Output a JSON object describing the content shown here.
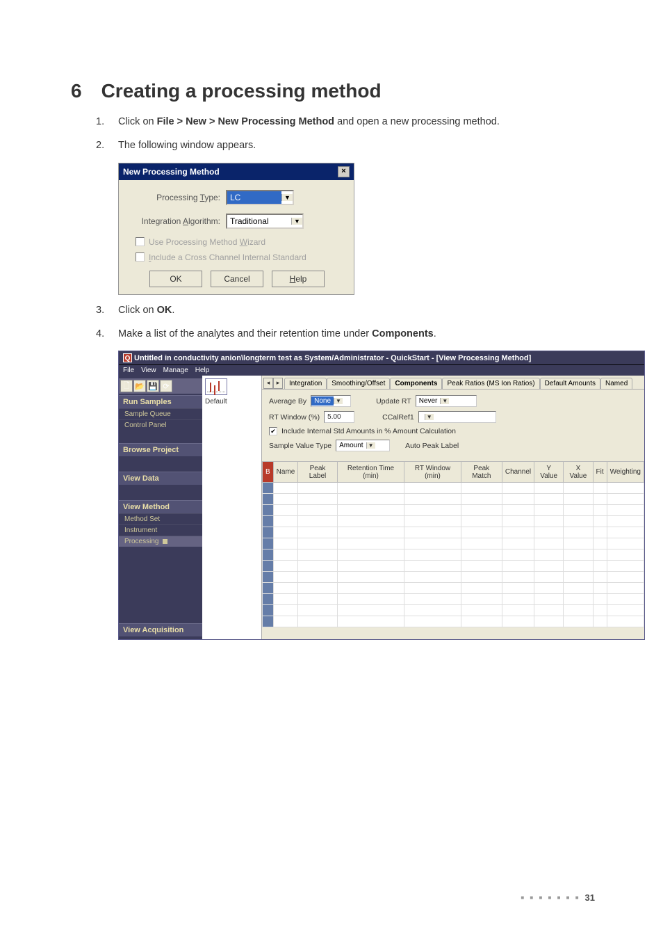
{
  "heading": {
    "number": "6",
    "title": "Creating a processing method"
  },
  "steps": {
    "1": {
      "num": "1.",
      "pre": "Click on ",
      "bold": "File > New > New Processing Method",
      "post": " and open a new processing method."
    },
    "2": {
      "num": "2.",
      "text": "The following window appears."
    },
    "3": {
      "num": "3.",
      "pre": "Click on ",
      "bold": "OK",
      "post": "."
    },
    "4": {
      "num": "4.",
      "pre": "Make a list of the analytes and their retention time under ",
      "bold": "Components",
      "post": "."
    }
  },
  "dialog1": {
    "title": "New Processing Method",
    "close": "×",
    "proc_type_label": "Processing Type:",
    "proc_type_value": "LC",
    "int_algo_label": "Integration Algorithm:",
    "int_algo_value": "Traditional",
    "chk1": "Use Processing Method Wizard",
    "chk2": "Include a Cross Channel Internal Standard",
    "ok": "OK",
    "cancel": "Cancel",
    "help": "Help"
  },
  "app": {
    "title": "Untitled in conductivity anion\\longterm test as System/Administrator - QuickStart - [View Processing Method]",
    "menu": {
      "file": "File",
      "view": "View",
      "manage": "Manage",
      "help": "Help"
    },
    "sidebar": {
      "run_samples": "Run Samples",
      "sample_queue": "Sample Queue",
      "control_panel": "Control Panel",
      "browse_project": "Browse Project",
      "view_data": "View Data",
      "view_method": "View Method",
      "method_set": "Method Set",
      "instrument": "Instrument",
      "processing": "Processing",
      "view_acq": "View Acquisition"
    },
    "tree": {
      "default": "Default"
    },
    "tabs": {
      "nav_left": "◂",
      "nav_right": "▸",
      "integration": "Integration",
      "smoothing": "Smoothing/Offset",
      "components": "Components",
      "peak_ratios": "Peak Ratios (MS Ion Ratios)",
      "default_amounts": "Default Amounts",
      "named": "Named"
    },
    "form": {
      "average_by_label": "Average By",
      "average_by_value": "None",
      "update_rt_label": "Update RT",
      "update_rt_value": "Never",
      "rt_window_label": "RT Window (%)",
      "rt_window_value": "5.00",
      "ccalref_label": "CCalRef1",
      "ccalref_value": "",
      "include_std_check": "Include Internal Std Amounts in % Amount Calculation",
      "sample_value_type_label": "Sample Value Type",
      "sample_value_type_value": "Amount",
      "auto_peak_label": "Auto Peak Label"
    },
    "grid": {
      "marker": "B",
      "name": "Name",
      "peak_label": "Peak Label",
      "ret_time": "Retention Time (min)",
      "rt_window": "RT Window (min)",
      "peak_match": "Peak Match",
      "channel": "Channel",
      "y_value": "Y Value",
      "x_value": "X Value",
      "fit": "Fit",
      "weighting": "Weighting"
    }
  },
  "footer": {
    "dots": "■ ■ ■ ■ ■ ■ ■",
    "page": "31"
  }
}
